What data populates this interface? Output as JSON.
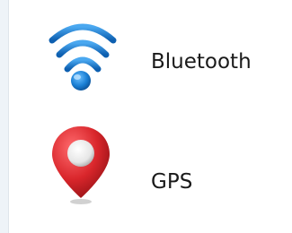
{
  "items": [
    {
      "label": "Bluetooth",
      "icon": "bluetooth-signal-icon",
      "color": "#1a7fd4"
    },
    {
      "label": "GPS",
      "icon": "map-pin-icon",
      "color": "#d9262b"
    }
  ]
}
